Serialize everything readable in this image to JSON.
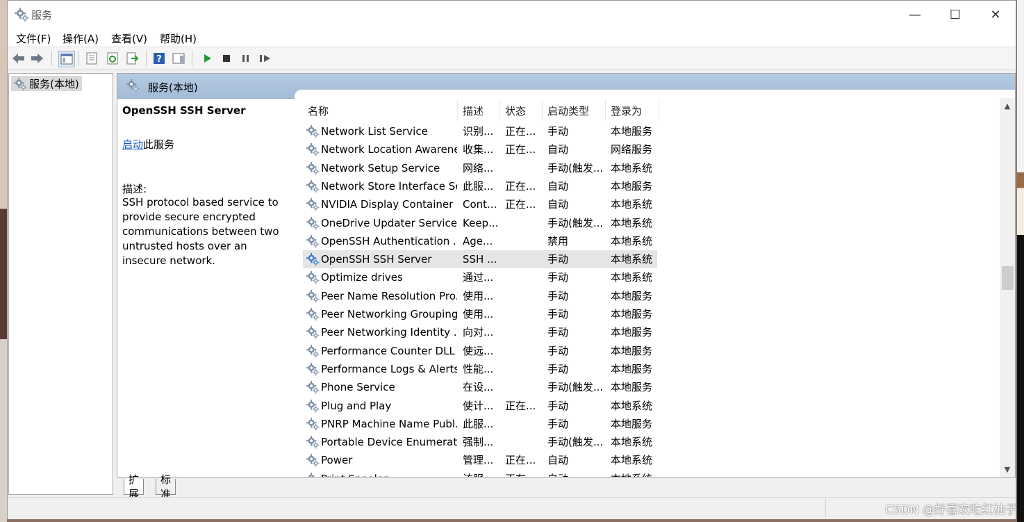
{
  "window": {
    "title": "服务",
    "controls": {
      "minimize": "—",
      "maximize": "☐",
      "close": "✕"
    }
  },
  "menubar": {
    "file": "文件(F)",
    "action": "操作(A)",
    "view": "查看(V)",
    "help": "帮助(H)"
  },
  "toolbar": {
    "icons": [
      "back-icon",
      "forward-icon",
      "show-console-tree-icon",
      "properties-icon",
      "refresh-icon",
      "export-list-icon",
      "help-icon",
      "show-action-pane-icon",
      "start-service-icon",
      "stop-service-icon",
      "pause-service-icon",
      "restart-service-icon"
    ]
  },
  "tree": {
    "root_label": "服务(本地)"
  },
  "main": {
    "header_title": "服务(本地)",
    "selected_service_name": "OpenSSH SSH Server",
    "start_link": "启动",
    "start_suffix": "此服务",
    "desc_label": "描述:",
    "description": "SSH protocol based service to provide secure encrypted communications between two untrusted hosts over an insecure network."
  },
  "table": {
    "columns": [
      "名称",
      "描述",
      "状态",
      "启动类型",
      "登录为"
    ],
    "rows": [
      {
        "name": "Network List Service",
        "desc": "识别...",
        "status": "正在...",
        "startup": "手动",
        "logon": "本地服务"
      },
      {
        "name": "Network Location Awarene...",
        "desc": "收集...",
        "status": "正在...",
        "startup": "自动",
        "logon": "网络服务"
      },
      {
        "name": "Network Setup Service",
        "desc": "网络...",
        "status": "",
        "startup": "手动(触发...",
        "logon": "本地系统"
      },
      {
        "name": "Network Store Interface Se...",
        "desc": "此服...",
        "status": "正在...",
        "startup": "自动",
        "logon": "本地服务"
      },
      {
        "name": "NVIDIA Display Container LS",
        "desc": "Cont...",
        "status": "正在...",
        "startup": "自动",
        "logon": "本地系统"
      },
      {
        "name": "OneDrive Updater Service",
        "desc": "Keep...",
        "status": "",
        "startup": "手动(触发...",
        "logon": "本地系统"
      },
      {
        "name": "OpenSSH Authentication ...",
        "desc": "Age...",
        "status": "",
        "startup": "禁用",
        "logon": "本地系统"
      },
      {
        "name": "OpenSSH SSH Server",
        "desc": "SSH ...",
        "status": "",
        "startup": "手动",
        "logon": "本地系统",
        "selected": true
      },
      {
        "name": "Optimize drives",
        "desc": "通过...",
        "status": "",
        "startup": "手动",
        "logon": "本地系统"
      },
      {
        "name": "Peer Name Resolution Pro...",
        "desc": "使用...",
        "status": "",
        "startup": "手动",
        "logon": "本地服务"
      },
      {
        "name": "Peer Networking Grouping",
        "desc": "使用...",
        "status": "",
        "startup": "手动",
        "logon": "本地服务"
      },
      {
        "name": "Peer Networking Identity ...",
        "desc": "向对...",
        "status": "",
        "startup": "手动",
        "logon": "本地服务"
      },
      {
        "name": "Performance Counter DLL ...",
        "desc": "使远...",
        "status": "",
        "startup": "手动",
        "logon": "本地服务"
      },
      {
        "name": "Performance Logs & Alerts",
        "desc": "性能...",
        "status": "",
        "startup": "手动",
        "logon": "本地服务"
      },
      {
        "name": "Phone Service",
        "desc": "在设...",
        "status": "",
        "startup": "手动(触发...",
        "logon": "本地服务"
      },
      {
        "name": "Plug and Play",
        "desc": "使计...",
        "status": "正在...",
        "startup": "手动",
        "logon": "本地系统"
      },
      {
        "name": "PNRP Machine Name Publ...",
        "desc": "此服...",
        "status": "",
        "startup": "手动",
        "logon": "本地服务"
      },
      {
        "name": "Portable Device Enumerat...",
        "desc": "强制...",
        "status": "",
        "startup": "手动(触发...",
        "logon": "本地系统"
      },
      {
        "name": "Power",
        "desc": "管理...",
        "status": "正在...",
        "startup": "自动",
        "logon": "本地系统"
      },
      {
        "name": "Print Spooler",
        "desc": "该服...",
        "status": "正在...",
        "startup": "自动",
        "logon": "本地系统"
      }
    ]
  },
  "tabs": {
    "extended": "扩展",
    "standard": "标准"
  },
  "watermark": "CSDN @好喜欢吃红柚子"
}
